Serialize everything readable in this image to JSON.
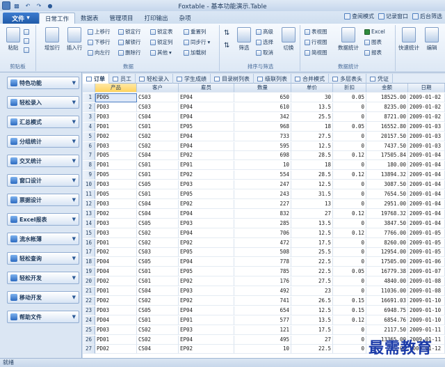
{
  "window": {
    "title": "Foxtable - 基本功能演示.Table"
  },
  "ribbon_tabs": [
    "文件",
    "日常工作",
    "数据表",
    "管理项目",
    "打印输出",
    "杂项"
  ],
  "active_tab": "日常工作",
  "right_actions": [
    "查阅模式",
    "记录窗口",
    "后台筛选"
  ],
  "groups": {
    "clipboard": {
      "label": "剪贴板",
      "paste": "粘贴"
    },
    "data": {
      "label": "数据",
      "add_row": "增加行",
      "insert_row": "插入行",
      "move_up": "上移行",
      "move_down": "下移行",
      "delete_row": "删除行",
      "lock_row": "锁定行",
      "unlock_row": "解锁行",
      "lock_table": "锁定表",
      "lock_col": "锁定列",
      "other": "其他",
      "reset_col": "重置列",
      "sync_col": "同步行",
      "add_tree": "加载树",
      "mark_row": "向左行"
    },
    "sort_filter": {
      "label": "排序与筛选",
      "filter": "筛选",
      "advanced": "高级",
      "select": "选择",
      "cancel": "取消",
      "switch": "切换"
    },
    "data_stats": {
      "label": "数据统计",
      "table_view": "表视图",
      "row_view": "行视图",
      "tree_view": "简视图",
      "data_stats": "数据统计",
      "excel": "Excel",
      "chart": "图表",
      "report": "报表",
      "quick_stats": "快速统计",
      "edit": "编辑"
    }
  },
  "sidebar": {
    "items": [
      "特色功能",
      "轻松录入",
      "汇总模式",
      "分组统计",
      "交叉统计",
      "窗口设计",
      "票据设计",
      "Excel报表",
      "流水帐薄",
      "轻松查询",
      "轻松开发",
      "移动开发",
      "帮助文件"
    ]
  },
  "sheet_tabs": [
    "订单",
    "员工",
    "轻松录入",
    "学生成绩",
    "目录树列表",
    "级联列表",
    "合并模式",
    "多层表头",
    "凭证"
  ],
  "active_sheet": "订单",
  "grid": {
    "columns": [
      "产品",
      "客户",
      "雇员",
      "数量",
      "单价",
      "折扣",
      "金额",
      "日期"
    ],
    "rows": [
      [
        "PD05",
        "CS03",
        "EP04",
        "650",
        "30",
        "0.05",
        "18525.00",
        "2009-01-02"
      ],
      [
        "PD03",
        "CS03",
        "EP04",
        "610",
        "13.5",
        "0",
        "8235.00",
        "2009-01-02"
      ],
      [
        "PD03",
        "CS04",
        "EP04",
        "342",
        "25.5",
        "0",
        "8721.00",
        "2009-01-02"
      ],
      [
        "PD01",
        "CS01",
        "EP05",
        "968",
        "18",
        "0.05",
        "16552.80",
        "2009-01-03"
      ],
      [
        "PD02",
        "CS02",
        "EP04",
        "733",
        "27.5",
        "0",
        "20157.50",
        "2009-01-03"
      ],
      [
        "PD03",
        "CS02",
        "EP04",
        "595",
        "12.5",
        "0",
        "7437.50",
        "2009-01-03"
      ],
      [
        "PD05",
        "CS04",
        "EP02",
        "698",
        "28.5",
        "0.12",
        "17505.84",
        "2009-01-04"
      ],
      [
        "PD01",
        "CS01",
        "EP01",
        "10",
        "18",
        "0",
        "180.00",
        "2009-01-04"
      ],
      [
        "PD05",
        "CS01",
        "EP02",
        "554",
        "28.5",
        "0.12",
        "13894.32",
        "2009-01-04"
      ],
      [
        "PD03",
        "CS05",
        "EP03",
        "247",
        "12.5",
        "0",
        "3087.50",
        "2009-01-04"
      ],
      [
        "PD05",
        "CS01",
        "EP05",
        "243",
        "31.5",
        "0",
        "7654.50",
        "2009-01-04"
      ],
      [
        "PD03",
        "CS04",
        "EP02",
        "227",
        "13",
        "0",
        "2951.00",
        "2009-01-04"
      ],
      [
        "PD02",
        "CS04",
        "EP04",
        "832",
        "27",
        "0.12",
        "19768.32",
        "2009-01-04"
      ],
      [
        "PD03",
        "CS05",
        "EP03",
        "285",
        "13.5",
        "0",
        "3847.50",
        "2009-01-04"
      ],
      [
        "PD03",
        "CS02",
        "EP04",
        "706",
        "12.5",
        "0.12",
        "7766.00",
        "2009-01-05"
      ],
      [
        "PD01",
        "CS02",
        "EP02",
        "472",
        "17.5",
        "0",
        "8260.00",
        "2009-01-05"
      ],
      [
        "PD02",
        "CS03",
        "EP05",
        "508",
        "25.5",
        "0",
        "12954.00",
        "2009-01-05"
      ],
      [
        "PD04",
        "CS05",
        "EP04",
        "778",
        "22.5",
        "0",
        "17505.00",
        "2009-01-06"
      ],
      [
        "PD04",
        "CS01",
        "EP05",
        "785",
        "22.5",
        "0.05",
        "16779.38",
        "2009-01-07"
      ],
      [
        "PD02",
        "CS01",
        "EP02",
        "176",
        "27.5",
        "0",
        "4840.00",
        "2009-01-08"
      ],
      [
        "PD01",
        "CS04",
        "EP03",
        "492",
        "23",
        "0",
        "11036.00",
        "2009-01-08"
      ],
      [
        "PD02",
        "CS02",
        "EP02",
        "741",
        "26.5",
        "0.15",
        "16691.03",
        "2009-01-10"
      ],
      [
        "PD03",
        "CS05",
        "EP04",
        "654",
        "12.5",
        "0.15",
        "6948.75",
        "2009-01-10"
      ],
      [
        "PD04",
        "CS01",
        "EP01",
        "577",
        "13.5",
        "0.12",
        "6854.76",
        "2009-01-10"
      ],
      [
        "PD03",
        "CS02",
        "EP03",
        "121",
        "17.5",
        "0",
        "2117.50",
        "2009-01-11"
      ],
      [
        "PD01",
        "CS02",
        "EP04",
        "495",
        "27",
        "0",
        "13365.00",
        "2009-01-11"
      ],
      [
        "PD02",
        "CS04",
        "EP02",
        "10",
        "22.5",
        "0",
        "225.00",
        "2009-01-12"
      ]
    ]
  },
  "status": {
    "text": "就绪"
  },
  "watermark": "最需教育"
}
